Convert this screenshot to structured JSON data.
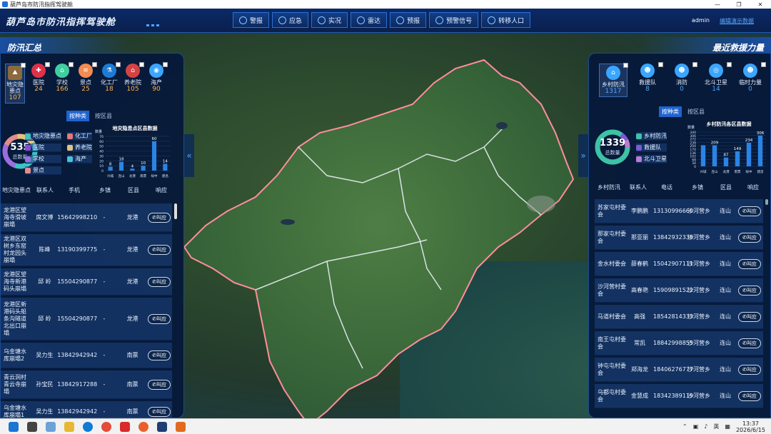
{
  "window": {
    "title": "葫芦岛市防汛指挥驾驶舱",
    "controls": [
      "—",
      "❐",
      "✕"
    ]
  },
  "header": {
    "title": "葫芦岛市防汛指挥驾驶舱",
    "nav": [
      "警报",
      "应急",
      "实况",
      "雷达",
      "预报",
      "预警信号",
      "转移人口"
    ],
    "user": "admin",
    "link": "编辑演示数据"
  },
  "left": {
    "title": "防汛汇总",
    "categories": [
      {
        "label": "地灾隐患点",
        "count": "107",
        "color": "#8b6a3e"
      },
      {
        "label": "医院",
        "count": "24",
        "color": "#e0314a"
      },
      {
        "label": "学校",
        "count": "166",
        "color": "#3fcf9f"
      },
      {
        "label": "景点",
        "count": "25",
        "color": "#f28b50"
      },
      {
        "label": "化工厂",
        "count": "18",
        "color": "#1d7bd6"
      },
      {
        "label": "养老院",
        "count": "105",
        "color": "#d44343"
      },
      {
        "label": "海产",
        "count": "90",
        "color": "#3aa6ff"
      }
    ],
    "toggle": [
      "按种类",
      "按区县"
    ],
    "donut": {
      "value": "535",
      "label": "总数量"
    },
    "legend": [
      {
        "label": "地灾隐患点",
        "color": "#3ec2c6"
      },
      {
        "label": "化工厂",
        "color": "#e07a7a"
      },
      {
        "label": "医院",
        "color": "#8a4ad6"
      },
      {
        "label": "养老院",
        "color": "#e6c27a"
      },
      {
        "label": "学校",
        "color": "#9b6ee0"
      },
      {
        "label": "海产",
        "color": "#49c1d8"
      },
      {
        "label": "景点",
        "color": "#e58b8b"
      }
    ],
    "chart_data": {
      "type": "bar",
      "title": "地灾隐患点区县数据",
      "ylabel": "数量",
      "categories": [
        "兴城",
        "连山",
        "龙港",
        "南票",
        "绥中",
        "建昌"
      ],
      "values": [
        8,
        18,
        4,
        10,
        60,
        14
      ],
      "ylim": [
        0,
        70
      ],
      "yticks": [
        "0",
        "10",
        "20",
        "30",
        "40",
        "50",
        "60",
        "70"
      ]
    },
    "table": {
      "headers": [
        "地灾隐患点",
        "联系人",
        "手机",
        "乡镇",
        "区县",
        "响应"
      ],
      "rows": [
        [
          "龙港区望海寺滑坡崩塌",
          "席文博",
          "15642998210",
          "-",
          "龙港",
          "叫应"
        ],
        [
          "龙港区双树乡东窑村龙园头崩塌",
          "陈峰",
          "13190399775",
          "-",
          "龙港",
          "叫应"
        ],
        [
          "龙港区望海寺新港码头崩塌",
          "邱 岭",
          "15504290877",
          "-",
          "龙港",
          "叫应"
        ],
        [
          "龙港区新港码头船条沟隧道北出口崩塌",
          "邱 岭",
          "15504290877",
          "-",
          "龙港",
          "叫应"
        ],
        [
          "乌金塘水库崩塌2",
          "吴力生",
          "13842942942",
          "-",
          "南票",
          "叫应"
        ],
        [
          "青云洞村青云寺崩塌",
          "孙宝民",
          "13842917288",
          "-",
          "南票",
          "叫应"
        ],
        [
          "乌金塘水库崩塌1",
          "吴力生",
          "13842942942",
          "-",
          "南票",
          "叫应"
        ]
      ]
    }
  },
  "right": {
    "title": "最近救援力量",
    "categories": [
      {
        "label": "乡村防汛",
        "count": "1317"
      },
      {
        "label": "救援队",
        "count": "8"
      },
      {
        "label": "消防",
        "count": "0"
      },
      {
        "label": "北斗卫星",
        "count": "14"
      },
      {
        "label": "临时力量",
        "count": "0"
      }
    ],
    "toggle": [
      "按种类",
      "按区县"
    ],
    "donut": {
      "value": "1339",
      "label": "总数量"
    },
    "legend": [
      {
        "label": "乡村防汛",
        "color": "#3ec2a6"
      },
      {
        "label": "救援队",
        "color": "#7a5ad6"
      },
      {
        "label": "北斗卫星",
        "color": "#c07ad6"
      }
    ],
    "chart_data": {
      "type": "bar",
      "title": "乡村防汛各区县数据",
      "ylabel": "数量",
      "categories": [
        "兴城",
        "连山",
        "龙港",
        "南票",
        "绥中",
        "建昌"
      ],
      "values": [
        209,
        209,
        87,
        149,
        234,
        306
      ],
      "ylim": [
        0,
        340
      ],
      "yticks": [
        "0",
        "34",
        "68",
        "102",
        "136",
        "170",
        "204",
        "238",
        "272",
        "306",
        "340"
      ],
      "data_labels": [
        "",
        "209",
        "87",
        "149",
        "234",
        "306"
      ]
    },
    "table": {
      "headers": [
        "乡村防汛",
        "联系人",
        "电话",
        "乡镇",
        "区县",
        "响应"
      ],
      "rows": [
        [
          "苏家屯村委会",
          "李鹏鹏",
          "13130996660",
          "沙河营乡",
          "连山",
          "叫应"
        ],
        [
          "那家屯村委会",
          "那亚丽",
          "13842932338",
          "沙河营乡",
          "连山",
          "叫应"
        ],
        [
          "金水村委会",
          "薛春鹤",
          "15042907111",
          "沙河营乡",
          "连山",
          "叫应"
        ],
        [
          "沙河营村委会",
          "高春艳",
          "15909891522",
          "沙河营乡",
          "连山",
          "叫应"
        ],
        [
          "马道村委会",
          "高强",
          "18542814333",
          "沙河营乡",
          "连山",
          "叫应"
        ],
        [
          "南王屯村委会",
          "常凯",
          "18842998855",
          "沙河营乡",
          "连山",
          "叫应"
        ],
        [
          "钟屯屯村委会",
          "郑海龙",
          "18406276777",
          "沙河营乡",
          "连山",
          "叫应"
        ],
        [
          "乌都屯村委会",
          "金慧成",
          "18342389119",
          "沙河营乡",
          "连山",
          "叫应"
        ]
      ]
    }
  },
  "taskbar": {
    "ime": "英",
    "time": "13:37",
    "date": "2026/6/15"
  }
}
